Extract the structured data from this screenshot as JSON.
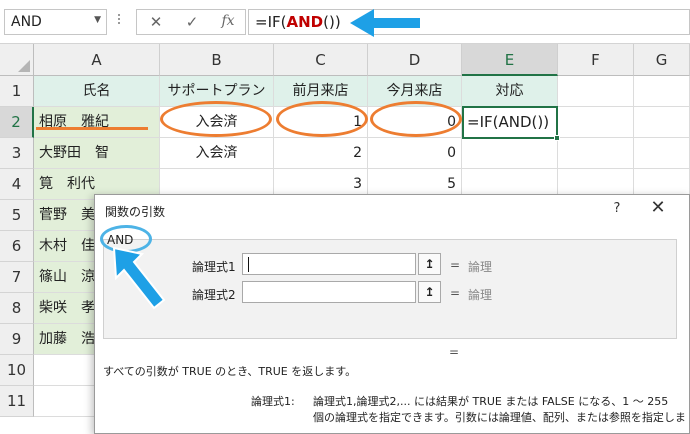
{
  "formula_bar": {
    "name_box": "AND",
    "name_box_arrow": "▼",
    "cancel_icon": "✕",
    "enter_icon": "✓",
    "fx_icon": "fx",
    "formula_prefix": "=IF(",
    "formula_fn": "AND",
    "formula_suffix": "())"
  },
  "grid": {
    "columns": [
      "A",
      "B",
      "C",
      "D",
      "E",
      "F",
      "G"
    ],
    "rows": [
      "1",
      "2",
      "3",
      "4",
      "5",
      "6",
      "7",
      "8",
      "9",
      "10",
      "11"
    ],
    "row1": [
      "氏名",
      "サポートプラン",
      "前月来店",
      "今月来店",
      "対応"
    ],
    "row2": [
      "相原　雅紀",
      "入会済",
      "1",
      "0",
      "=IF(AND())"
    ],
    "row3": [
      "大野田　智",
      "入会済",
      "2",
      "0"
    ],
    "row4": [
      "筧　利代",
      "",
      "3",
      "5"
    ],
    "names_partial": [
      "菅野　美",
      "木村　佳",
      "篠山　涼",
      "柴咲　孝",
      "加藤　浩"
    ]
  },
  "dialog": {
    "title": "関数の引数",
    "help": "?",
    "close": "✕",
    "function_name": "AND",
    "args": [
      {
        "label": "論理式1",
        "eq": "=",
        "result": "論理"
      },
      {
        "label": "論理式2",
        "eq": "=",
        "result": "論理"
      }
    ],
    "ref_button": "↥",
    "total_eq": "=",
    "description": "すべての引数が TRUE のとき、TRUE を返します。",
    "arg_help_label": "論理式1:",
    "arg_help_line1": "論理式1,論理式2,... には結果が TRUE または FALSE になる、1 ～ 255",
    "arg_help_line2": "個の論理式を指定できます。引数には論理値、配列、または参照を指定しま"
  },
  "colors": {
    "accent_green": "#217346",
    "annotation_orange": "#ed7d31",
    "annotation_blue": "#1ea0e6",
    "header_fill": "#dff1ea",
    "name_fill": "#e2efd9"
  }
}
